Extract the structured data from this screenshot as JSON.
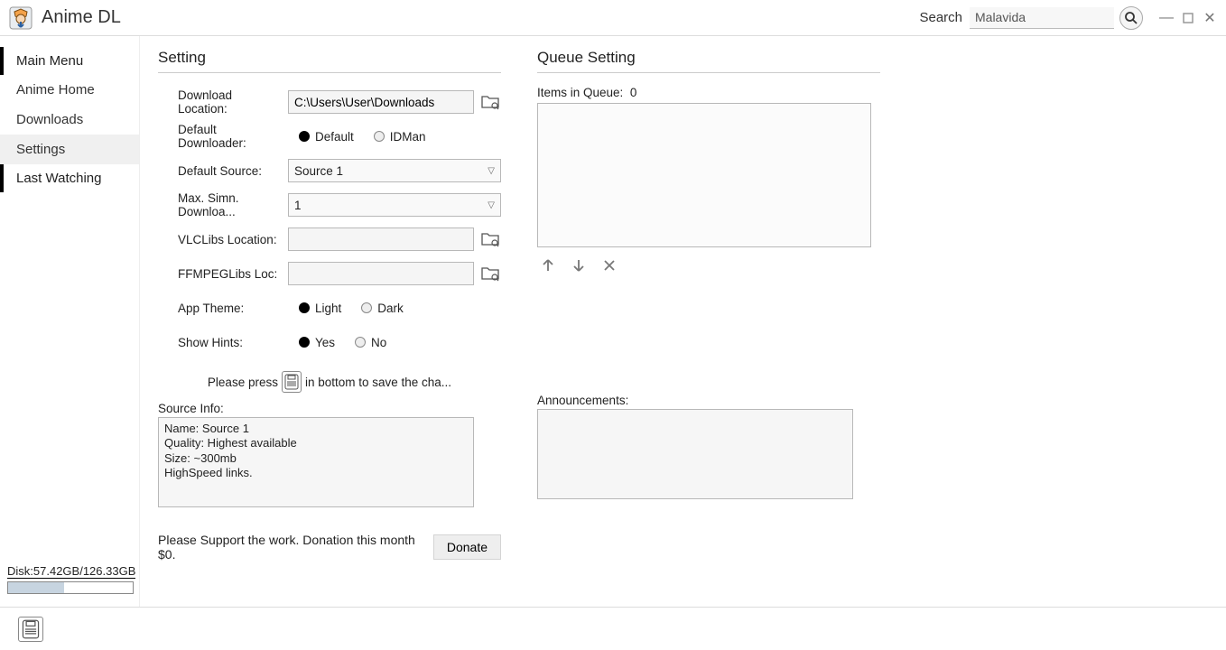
{
  "app": {
    "title": "Anime DL"
  },
  "search": {
    "label": "Search",
    "value": "Malavida"
  },
  "sidebar": {
    "main_heading": "Main Menu",
    "items": [
      "Anime Home",
      "Downloads",
      "Settings"
    ],
    "selected_index": 2,
    "last_heading": "Last Watching",
    "disk_label": "Disk:57.42GB/126.33GB",
    "disk_fill_pct": 45
  },
  "settings": {
    "title": "Setting",
    "download_location": {
      "label": "Download Location:",
      "value": "C:\\Users\\User\\Downloads"
    },
    "default_downloader": {
      "label": "Default Downloader:",
      "opt1": "Default",
      "opt2": "IDMan",
      "selected": "Default"
    },
    "default_source": {
      "label": "Default Source:",
      "value": "Source 1"
    },
    "max_simul": {
      "label": "Max. Simn. Downloa...",
      "value": "1"
    },
    "vlclibs": {
      "label": "VLCLibs Location:",
      "value": ""
    },
    "ffmpeglibs": {
      "label": "FFMPEGLibs Loc:",
      "value": ""
    },
    "app_theme": {
      "label": "App Theme:",
      "opt1": "Light",
      "opt2": "Dark",
      "selected": "Light"
    },
    "show_hints": {
      "label": "Show Hints:",
      "opt1": "Yes",
      "opt2": "No",
      "selected": "Yes"
    },
    "hint_pre": "Please press",
    "hint_post": "in bottom to save the cha...",
    "source_info_label": "Source Info:",
    "source_info_text": "Name: Source 1\nQuality: Highest available\nSize: ~300mb\nHighSpeed links.",
    "donate_text": "Please Support the work. Donation this month $0.",
    "donate_btn": "Donate"
  },
  "queue": {
    "title": "Queue Setting",
    "items_label": "Items in Queue:",
    "items_count": "0",
    "ann_label": "Announcements:"
  }
}
